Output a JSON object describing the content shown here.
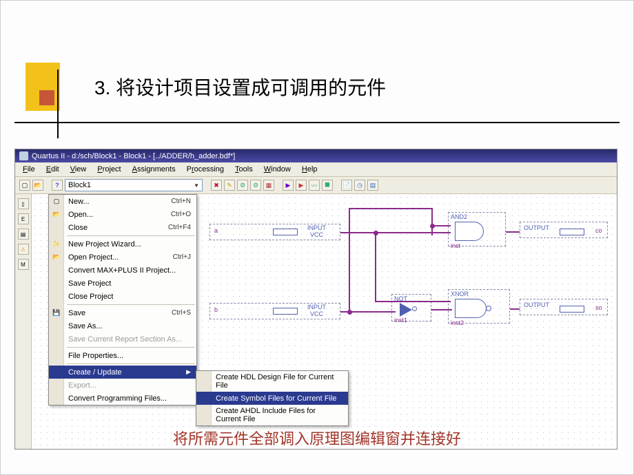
{
  "slide": {
    "title": "3. 将设计项目设置成可调用的元件",
    "bottom_text": "将所需元件全部调入原理图编辑窗并连接好"
  },
  "app": {
    "title": "Quartus II - d:/sch/Block1 - Block1 - [../ADDER/h_adder.bdf*]",
    "combo_value": "Block1",
    "menubar": [
      "File",
      "Edit",
      "View",
      "Project",
      "Assignments",
      "Processing",
      "Tools",
      "Window",
      "Help"
    ]
  },
  "file_menu": {
    "new": "New...",
    "new_sc": "Ctrl+N",
    "open": "Open...",
    "open_sc": "Ctrl+O",
    "close": "Close",
    "close_sc": "Ctrl+F4",
    "new_wizard": "New Project Wizard...",
    "open_project": "Open Project...",
    "open_project_sc": "Ctrl+J",
    "convert": "Convert MAX+PLUS II Project...",
    "save_project": "Save Project",
    "close_project": "Close Project",
    "save": "Save",
    "save_sc": "Ctrl+S",
    "save_as": "Save As...",
    "save_report": "Save Current Report Section As...",
    "file_props": "File Properties...",
    "create_update": "Create / Update",
    "export": "Export...",
    "convert_prog": "Convert Programming Files..."
  },
  "create_submenu": {
    "hdl": "Create HDL Design File for Current File",
    "symbol": "Create Symbol Files for Current File",
    "ahdl": "Create AHDL Include Files for Current File"
  },
  "schematic": {
    "pin_a": "a",
    "pin_b": "b",
    "input_label": "INPUT",
    "vcc_label": "VCC",
    "and_label": "AND2",
    "xnor_label": "XNOR",
    "not_label": "NOT",
    "inst": "inst",
    "inst1": "inst1",
    "inst2": "inst2",
    "output_label": "OUTPUT",
    "out_co": "co",
    "out_so": "so"
  }
}
